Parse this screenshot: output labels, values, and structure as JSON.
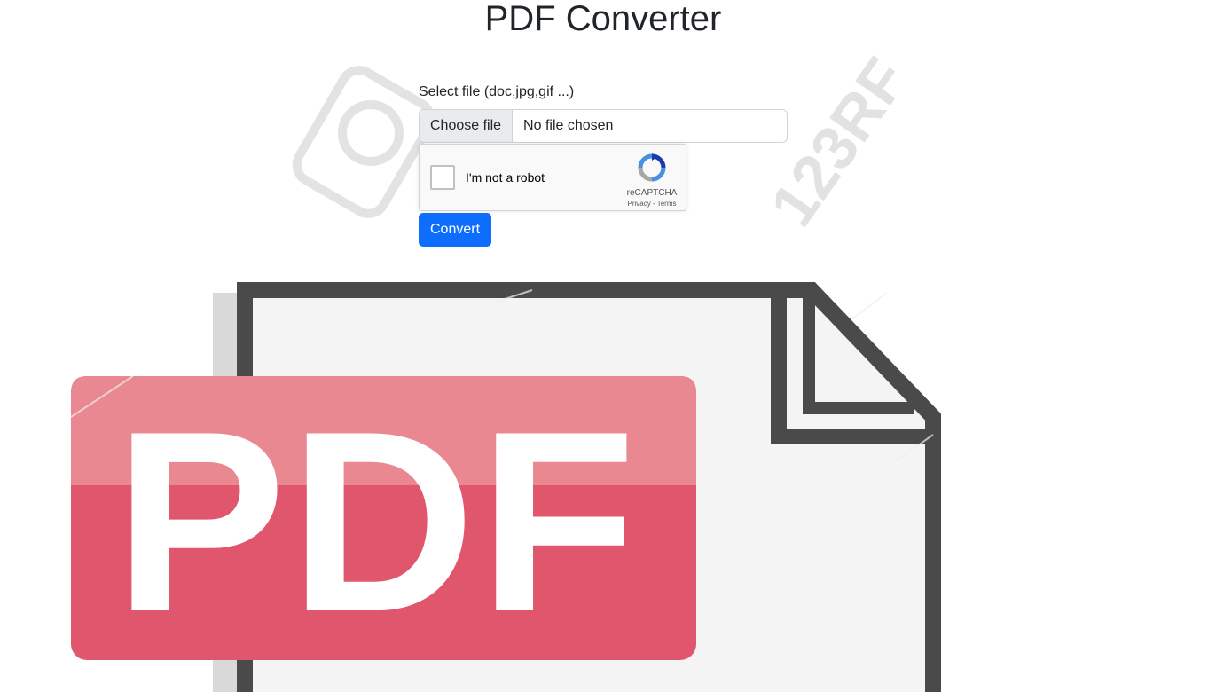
{
  "page": {
    "title": "PDF Converter"
  },
  "form": {
    "file_label": "Select file (doc,jpg,gif ...)",
    "file_button": "Choose file",
    "file_status": "No file chosen",
    "convert_button": "Convert"
  },
  "captcha": {
    "checkbox_label": "I'm not a robot",
    "brand": "reCAPTCHA",
    "privacy_link": "Privacy",
    "separator": "-",
    "terms_link": "Terms"
  },
  "illustration": {
    "icon": "pdf-document-icon",
    "badge_text": "PDF",
    "watermark_text": "123RF",
    "colors": {
      "badge": "#e0566c",
      "badge_highlight": "#ea8892",
      "outline": "#4a4a4a",
      "page": "#f4f4f4"
    }
  },
  "colors": {
    "primary": "#0d6efd",
    "text": "#212529",
    "input_border": "#ced4da",
    "file_button_bg": "#e9ecef"
  }
}
